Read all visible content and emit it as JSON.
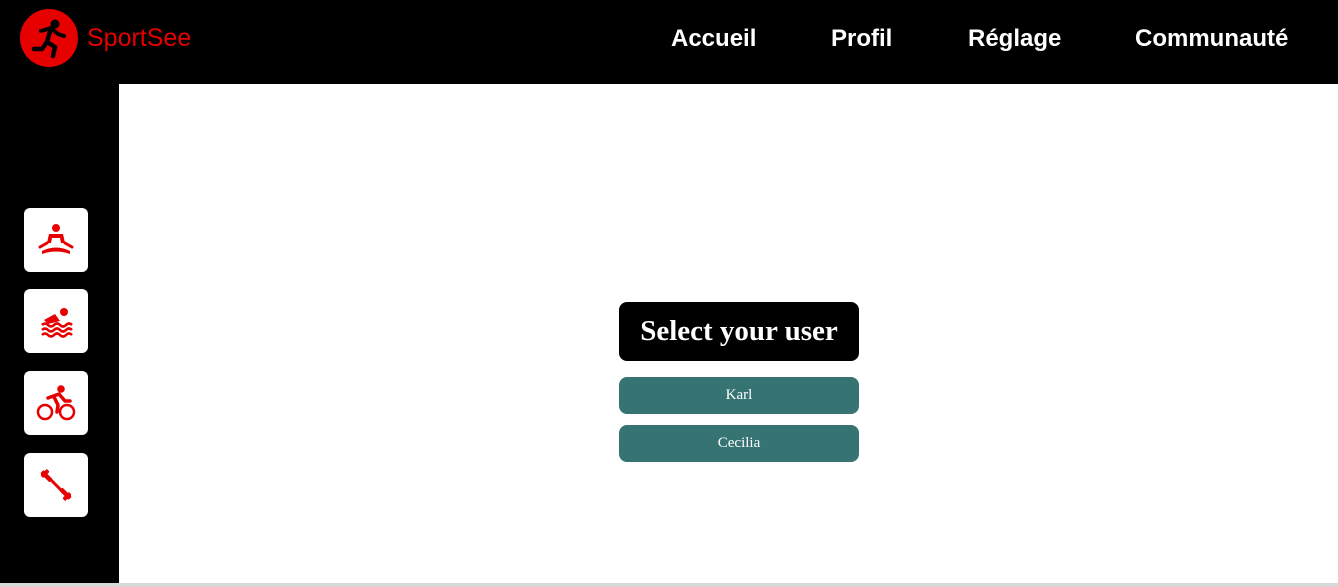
{
  "brand": {
    "name": "SportSee",
    "logo_icon": "running-man-icon",
    "color": "#e60000"
  },
  "nav": {
    "items": [
      {
        "label": "Accueil"
      },
      {
        "label": "Profil"
      },
      {
        "label": "Réglage"
      },
      {
        "label": "Communauté"
      }
    ]
  },
  "sidebar": {
    "items": [
      {
        "icon": "yoga-icon"
      },
      {
        "icon": "swimming-icon"
      },
      {
        "icon": "cycling-icon"
      },
      {
        "icon": "dumbbell-icon"
      }
    ]
  },
  "main": {
    "title": "Select your user",
    "users": [
      {
        "label": "Karl"
      },
      {
        "label": "Cecilia"
      }
    ],
    "button_color": "#367474"
  }
}
